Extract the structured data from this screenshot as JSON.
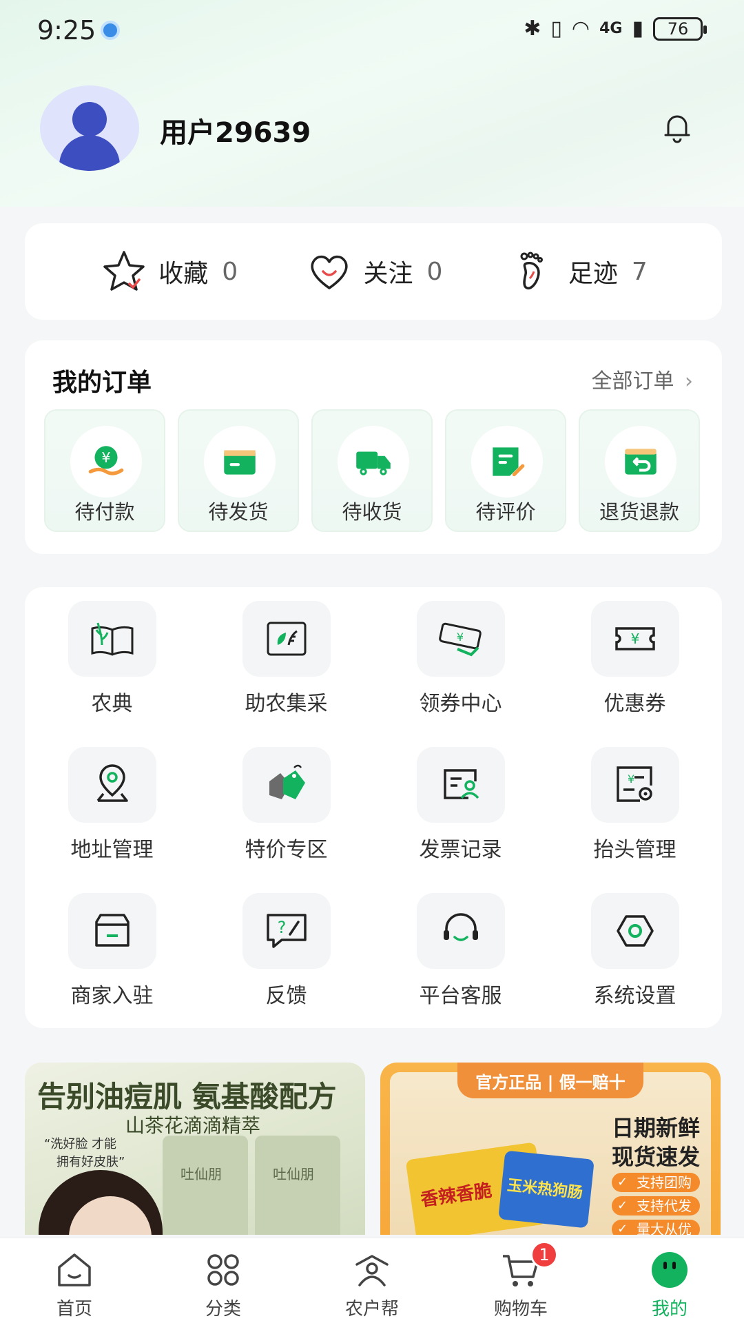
{
  "status_bar": {
    "time": "9:25",
    "battery": "76",
    "network": "4G"
  },
  "profile": {
    "username": "用户29639"
  },
  "stats": [
    {
      "label": "收藏",
      "value": "0",
      "icon": "star-icon"
    },
    {
      "label": "关注",
      "value": "0",
      "icon": "heart-icon"
    },
    {
      "label": "足迹",
      "value": "7",
      "icon": "footprint-icon"
    }
  ],
  "orders": {
    "title": "我的订单",
    "all_label": "全部订单",
    "items": [
      {
        "label": "待付款",
        "icon": "payment-icon"
      },
      {
        "label": "待发货",
        "icon": "package-icon"
      },
      {
        "label": "待收货",
        "icon": "truck-icon"
      },
      {
        "label": "待评价",
        "icon": "review-icon"
      },
      {
        "label": "退货退款",
        "icon": "refund-icon"
      }
    ]
  },
  "services": [
    {
      "label": "农典",
      "icon": "farm-book-icon"
    },
    {
      "label": "助农集采",
      "icon": "leaf-card-icon"
    },
    {
      "label": "领券中心",
      "icon": "coupon-ticket-icon"
    },
    {
      "label": "优惠券",
      "icon": "yuan-coupon-icon"
    },
    {
      "label": "地址管理",
      "icon": "location-pin-icon"
    },
    {
      "label": "特价专区",
      "icon": "sale-tag-icon"
    },
    {
      "label": "发票记录",
      "icon": "invoice-icon"
    },
    {
      "label": "抬头管理",
      "icon": "invoice-header-icon"
    },
    {
      "label": "商家入驻",
      "icon": "store-icon"
    },
    {
      "label": "反馈",
      "icon": "feedback-icon"
    },
    {
      "label": "平台客服",
      "icon": "headset-icon"
    },
    {
      "label": "系统设置",
      "icon": "settings-icon"
    }
  ],
  "banner_left": {
    "title": "告别油痘肌 氨基酸配方",
    "subtitle": "山茶花滴滴精萃",
    "quote_line1": "“洗好脸 才能",
    "quote_line2": "拥有好皮肤”",
    "brand": "吐仙朋"
  },
  "banner_right": {
    "tag": "官方正品 | 假一赔十",
    "headline1": "日期新鲜",
    "headline2": "现货速发",
    "features": [
      "支持团购",
      "支持代发",
      "量大从优"
    ],
    "product1": "香辣香脆",
    "product2": "玉米热狗肠"
  },
  "nav": {
    "items": [
      {
        "label": "首页",
        "icon": "home-icon"
      },
      {
        "label": "分类",
        "icon": "category-icon"
      },
      {
        "label": "农户帮",
        "icon": "farmer-icon"
      },
      {
        "label": "购物车",
        "icon": "cart-icon",
        "badge": "1"
      },
      {
        "label": "我的",
        "icon": "me-icon",
        "active": true
      }
    ]
  },
  "colors": {
    "accent": "#13b25e",
    "badge": "#f03d3d",
    "avatar": "#3d4ec0"
  }
}
